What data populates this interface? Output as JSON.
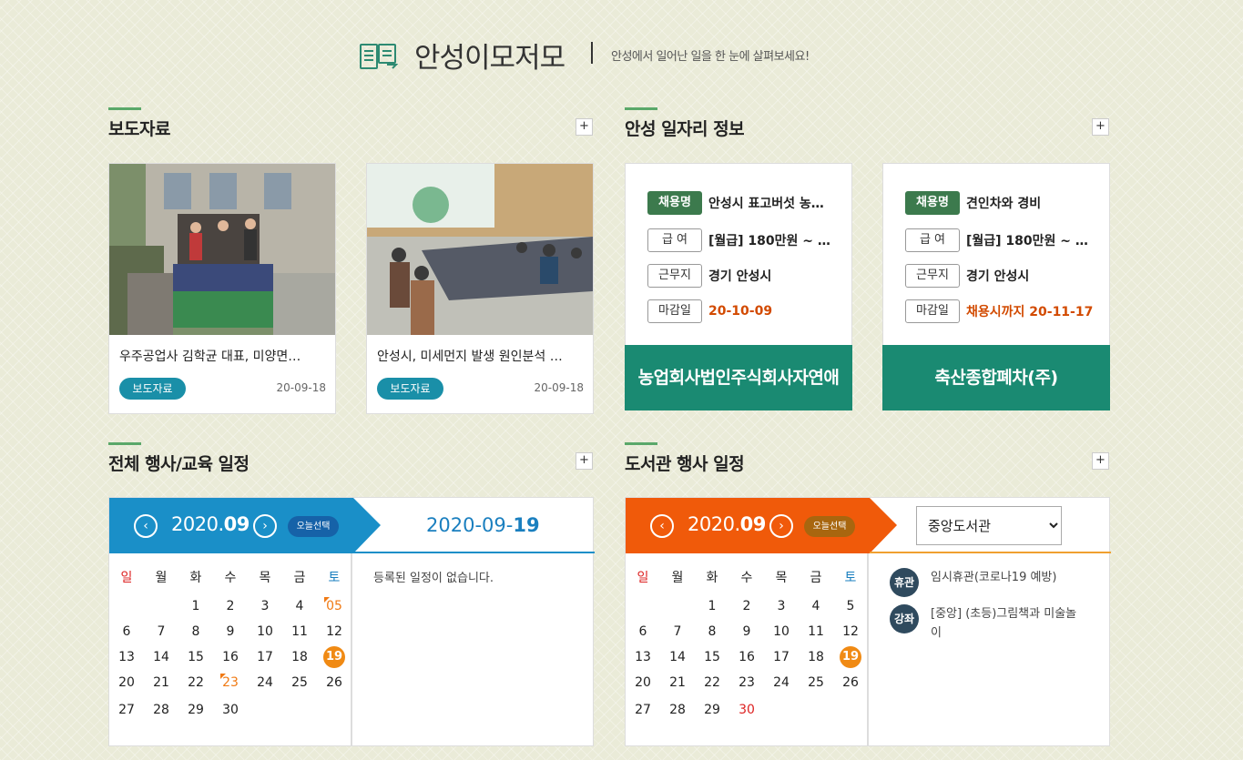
{
  "header": {
    "title": "안성이모저모",
    "subtitle": "안성에서 일어난 일을 한 눈에 살펴보세요!"
  },
  "sections": {
    "press": {
      "title": "보도자료",
      "more": "+"
    },
    "jobs": {
      "title": "안성 일자리 정보",
      "more": "+"
    },
    "events": {
      "title": "전체 행사/교육 일정",
      "more": "+"
    },
    "library": {
      "title": "도서관 행사 일정",
      "more": "+"
    }
  },
  "press_items": [
    {
      "title": "우주공업사 김학균 대표, 미양면…",
      "tag": "보도자료",
      "date": "20-09-18"
    },
    {
      "title": "안성시, 미세먼지 발생 원인분석 …",
      "tag": "보도자료",
      "date": "20-09-18"
    }
  ],
  "job_labels": {
    "position": "채용명",
    "salary": "급 여",
    "location": "근무지",
    "deadline": "마감일"
  },
  "job_items": [
    {
      "position": "안성시 표고버섯 농…",
      "salary": "[월급] 180만원 ~ …",
      "location": "경기 안성시",
      "deadline": "20-10-09",
      "company": "농업회사법인주식회사자연애"
    },
    {
      "position": "견인차와 경비",
      "salary": "[월급] 180만원 ~ …",
      "location": "경기 안성시",
      "deadline": "채용시까지 20-11-17",
      "company": "축산종합폐차(주)"
    }
  ],
  "calendar_events": {
    "year_month_prefix": "2020.",
    "month": "09",
    "today_button": "오늘선택",
    "selected_date_prefix": "2020-09-",
    "selected_day": "19",
    "empty_text": "등록된 일정이 없습니다.",
    "weekdays": [
      "일",
      "월",
      "화",
      "수",
      "목",
      "금",
      "토"
    ],
    "weeks": [
      [
        "",
        "",
        "1",
        "2",
        "3",
        "4",
        "05"
      ],
      [
        "6",
        "7",
        "8",
        "9",
        "10",
        "11",
        "12"
      ],
      [
        "13",
        "14",
        "15",
        "16",
        "17",
        "18",
        "19"
      ],
      [
        "20",
        "21",
        "22",
        "23",
        "24",
        "25",
        "26"
      ],
      [
        "27",
        "28",
        "29",
        "30",
        "",
        "",
        ""
      ]
    ],
    "colors": {
      "head": "#1a8fc8",
      "today_btn": "#1662a8",
      "selected": "#f08a14"
    }
  },
  "calendar_library": {
    "year_month_prefix": "2020.",
    "month": "09",
    "today_button": "오늘선택",
    "library_select": "중앙도서관",
    "weekdays": [
      "일",
      "월",
      "화",
      "수",
      "목",
      "금",
      "토"
    ],
    "weeks": [
      [
        "",
        "",
        "1",
        "2",
        "3",
        "4",
        "5"
      ],
      [
        "6",
        "7",
        "8",
        "9",
        "10",
        "11",
        "12"
      ],
      [
        "13",
        "14",
        "15",
        "16",
        "17",
        "18",
        "19"
      ],
      [
        "20",
        "21",
        "22",
        "23",
        "24",
        "25",
        "26"
      ],
      [
        "27",
        "28",
        "29",
        "30",
        "",
        "",
        ""
      ]
    ],
    "events": [
      {
        "badge": "휴관",
        "text": "임시휴관(코로나19 예방)"
      },
      {
        "badge": "강좌",
        "text": "[중앙] (초등)그림책과 미술놀이"
      }
    ],
    "colors": {
      "head": "#f05a0a",
      "today_btn": "#a8660f",
      "accent": "#f0a030"
    }
  }
}
